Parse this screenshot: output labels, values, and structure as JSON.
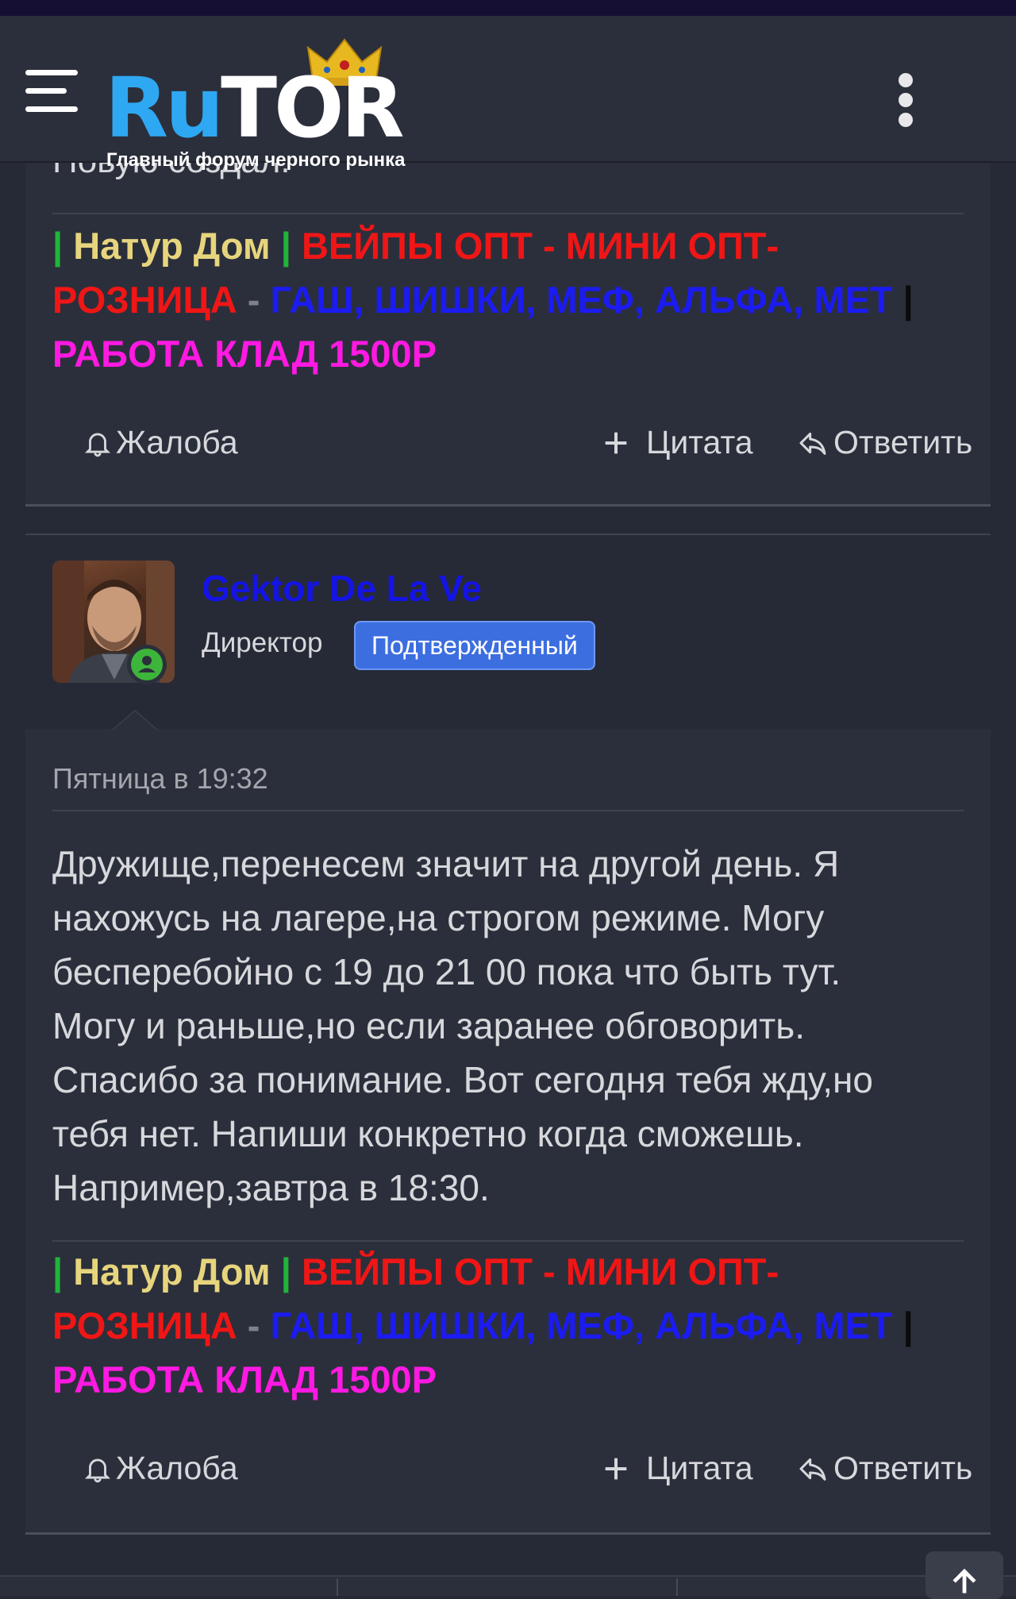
{
  "header": {
    "logo_ru": "Ru",
    "logo_tor": "TOR",
    "logo_tagline": "Главный форум черного рынка",
    "menu_icon": "hamburger-icon",
    "more_icon": "kebab-icon"
  },
  "post1": {
    "partial_text": "Новую создал.",
    "signature": {
      "bar_left": "|",
      "shop": "Натур Дом",
      "bar_mid": "|",
      "line1_red": "ВЕЙПЫ ОПТ - МИНИ ОПТ-",
      "line2_red": "РОЗНИЦА",
      "dash": " - ",
      "products": "ГАШ, ШИШКИ, МЕФ, АЛЬФА, МЕТ",
      "bar_end": "|",
      "job": "РАБОТА КЛАД 1500Р"
    },
    "actions": {
      "report": "Жалоба",
      "quote": "Цитата",
      "reply": "Ответить"
    }
  },
  "post2": {
    "author": {
      "name": "Gektor De La Ve",
      "title": "Директор",
      "badge": "Подтвержденный"
    },
    "date": "Пятница в 19:32",
    "body_lines": [
      "Дружище,перенесем значит на другой день. Я",
      "нахожусь на лагере,на строгом режиме. Могу",
      "бесперебойно с 19 до 21 00 пока что быть тут.",
      "Могу и раньше,но если заранее обговорить.",
      "Спасибо за понимание. Вот сегодня тебя жду,но",
      "тебя нет. Напиши конкретно когда сможешь.",
      "Например,завтра в 18:30."
    ],
    "signature": {
      "bar_left": "|",
      "shop": "Натур Дом",
      "bar_mid": "|",
      "line1_red": "ВЕЙПЫ ОПТ - МИНИ ОПТ-",
      "line2_red": "РОЗНИЦА",
      "dash": " - ",
      "products": "ГАШ, ШИШКИ, МЕФ, АЛЬФА, МЕТ",
      "bar_end": "|",
      "job": "РАБОТА КЛАД 1500Р"
    },
    "actions": {
      "report": "Жалоба",
      "quote": "Цитата",
      "reply": "Ответить"
    }
  },
  "colors": {
    "background": "#262a36",
    "card": "#2b2f3b",
    "logo_blue": "#2ea8f2",
    "username_blue": "#1414e6",
    "badge_blue": "#3c6ee0",
    "sig_green": "#21b43a",
    "sig_yellow": "#e7d57d",
    "sig_red": "#f01616",
    "sig_blue": "#1b1bf2",
    "sig_magenta": "#ff19e2"
  }
}
